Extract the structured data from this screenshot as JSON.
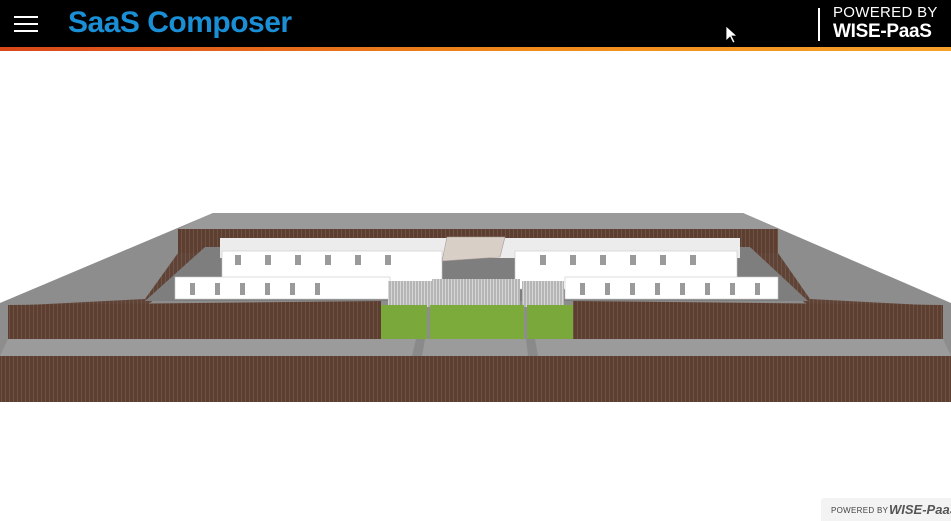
{
  "header": {
    "app_title": "SaaS Composer",
    "powered_by": "POWERED BY",
    "brand": "WISE-PaaS",
    "menu_icon": "hamburger-menu-icon"
  },
  "colors": {
    "header_bg": "#000000",
    "title_blue": "#1a8fd6",
    "accent_orange": "#f08a1c",
    "wall_brown": "#5b3d2f",
    "floor_gray": "#8a8a8a",
    "room_white": "#f2f2f2",
    "glass_green": "#7aa83a"
  },
  "footer_badge": {
    "powered_by": "POWERED BY",
    "brand": "WISE-PaaS"
  }
}
